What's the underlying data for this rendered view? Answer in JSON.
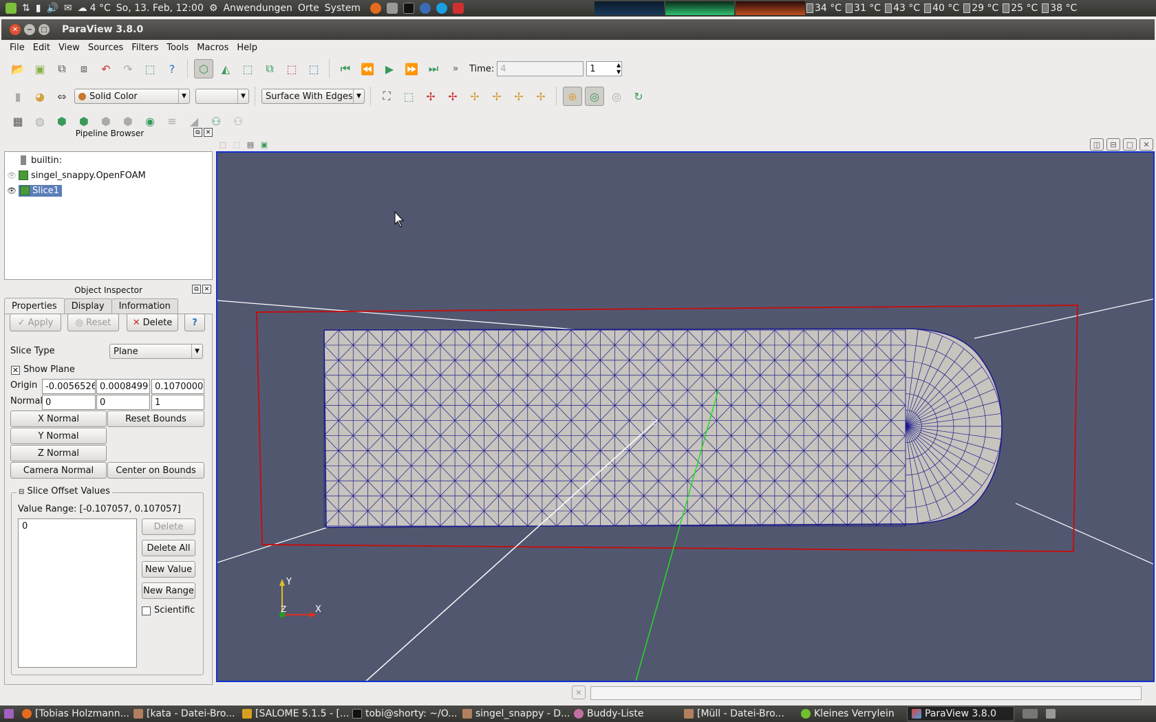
{
  "top_panel": {
    "weather": "4 °C",
    "clock": "So, 13. Feb, 12:00",
    "menus": [
      "Anwendungen",
      "Orte",
      "System"
    ],
    "temps": [
      "34 °C",
      "31 °C",
      "43 °C",
      "40 °C",
      "29 °C",
      "25 °C",
      "38 °C"
    ]
  },
  "window": {
    "title": "ParaView 3.8.0"
  },
  "menubar": [
    "File",
    "Edit",
    "View",
    "Sources",
    "Filters",
    "Tools",
    "Macros",
    "Help"
  ],
  "toolbar": {
    "more": "»",
    "time_label": "Time:",
    "time_value": "4",
    "timestep": "1",
    "color_by": "Solid Color",
    "component": "",
    "representation": "Surface With Edges"
  },
  "pipeline": {
    "title": "Pipeline Browser",
    "items": [
      {
        "label": "builtin:"
      },
      {
        "label": "singel_snappy.OpenFOAM"
      },
      {
        "label": "Slice1"
      }
    ]
  },
  "inspector": {
    "title": "Object Inspector",
    "tabs": [
      "Properties",
      "Display",
      "Information"
    ],
    "apply": "Apply",
    "reset": "Reset",
    "delete": "Delete",
    "help": "?",
    "slice_type_label": "Slice Type",
    "slice_type": "Plane",
    "show_plane": "Show Plane",
    "origin_label": "Origin",
    "origin": [
      "-0.0056526",
      "0.0008499",
      "0.1070000"
    ],
    "normal_label": "Normal",
    "normal": [
      "0",
      "0",
      "1"
    ],
    "x_normal": "X Normal",
    "y_normal": "Y Normal",
    "z_normal": "Z Normal",
    "reset_bounds": "Reset Bounds",
    "camera_normal": "Camera Normal",
    "center_on_bounds": "Center on Bounds",
    "offsets_title": "Slice Offset Values",
    "value_range": "Value Range: [-0.107057, 0.107057]",
    "values": [
      "0"
    ],
    "delete_value": "Delete",
    "delete_all": "Delete All",
    "new_value": "New Value",
    "new_range": "New Range",
    "scientific": "Scientific"
  },
  "axes": {
    "y": "Y",
    "z": "Z",
    "x": "X"
  },
  "taskbar": [
    "[Tobias Holzmann...",
    "[kata - Datei-Bro...",
    "[SALOME 5.1.5 - [...",
    "tobi@shorty: ~/O...",
    "singel_snappy - D...",
    "Buddy-Liste",
    "[Müll - Datei-Bro...",
    "Kleines Verrylein",
    "ParaView 3.8.0"
  ],
  "colors": {
    "viewport_bg": "#525770",
    "mesh_fill": "#c8c4be",
    "mesh_lines": "#1a1a8a",
    "plane_outline": "#c01010",
    "accent": "#1030d0"
  }
}
